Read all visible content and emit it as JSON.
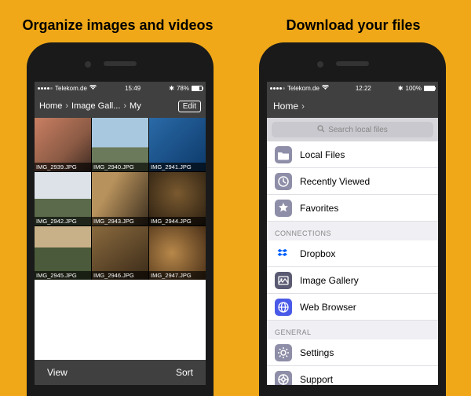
{
  "titles": {
    "left": "Organize images and videos",
    "right": "Download your files"
  },
  "status": {
    "carrier": "Telekom.de",
    "time_left": "15:49",
    "time_right": "12:22",
    "bt_left": "78%",
    "bt_right": "100%"
  },
  "left": {
    "breadcrumb": [
      "Home",
      "Image Gall...",
      "My"
    ],
    "edit": "Edit",
    "thumbs": [
      "IMG_2939.JPG",
      "IMG_2940.JPG",
      "IMG_2941.JPG",
      "IMG_2942.JPG",
      "IMG_2943.JPG",
      "IMG_2944.JPG",
      "IMG_2945.JPG",
      "IMG_2946.JPG",
      "IMG_2947.JPG"
    ],
    "toolbar": {
      "view": "View",
      "sort": "Sort"
    }
  },
  "right": {
    "breadcrumb": "Home",
    "search_placeholder": "Search local files",
    "top_rows": [
      {
        "label": "Local Files",
        "icon": "folder",
        "color": "#8e8ea8"
      },
      {
        "label": "Recently Viewed",
        "icon": "clock",
        "color": "#8e8ea8"
      },
      {
        "label": "Favorites",
        "icon": "star",
        "color": "#8e8ea8"
      }
    ],
    "sections": [
      {
        "header": "CONNECTIONS",
        "rows": [
          {
            "label": "Dropbox",
            "icon": "dropbox",
            "color": "#ffffff"
          },
          {
            "label": "Image Gallery",
            "icon": "image",
            "color": "#5a5a72"
          },
          {
            "label": "Web Browser",
            "icon": "globe",
            "color": "#4a5ae8"
          }
        ]
      },
      {
        "header": "GENERAL",
        "rows": [
          {
            "label": "Settings",
            "icon": "gear",
            "color": "#8e8ea8"
          },
          {
            "label": "Support",
            "icon": "support",
            "color": "#8e8ea8"
          }
        ]
      }
    ]
  }
}
